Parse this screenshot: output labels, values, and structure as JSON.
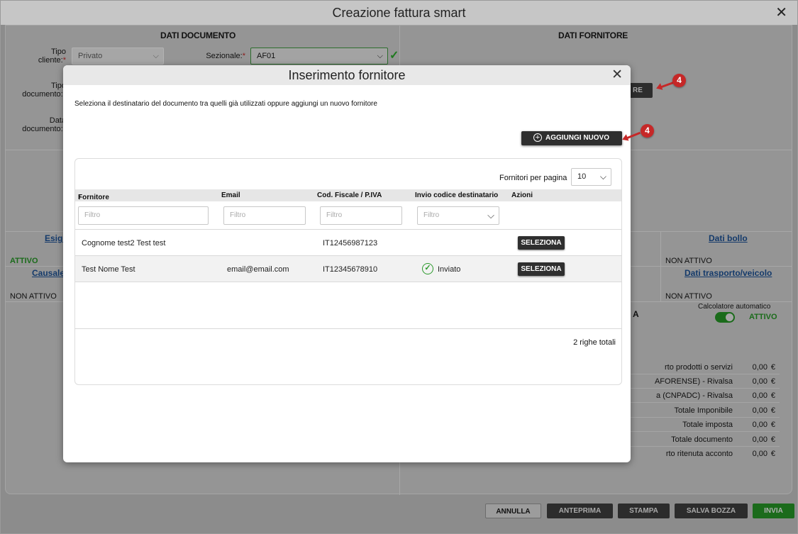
{
  "window": {
    "title": "Creazione fattura smart"
  },
  "dati_documento": {
    "title": "DATI DOCUMENTO",
    "tipo_cliente_label": "Tipo cliente:",
    "tipo_cliente_value": "Privato",
    "sezionale_label": "Sezionale:",
    "sezionale_value": "AF01",
    "tipo_documento_label": "Tipo documento:",
    "data_documento_label": "Data documento:"
  },
  "dati_fornitore": {
    "title": "DATI FORNITORE",
    "button_partial": "RE"
  },
  "sections": {
    "esigibilita_link": "Esigi",
    "esigibilita_status": "ATTIVO",
    "causale_link": "Causale",
    "causale_status": "NON ATTIVO",
    "dati_bollo_link": "Dati bollo",
    "dati_bollo_status": "NON ATTIVO",
    "trasporto_link": "Dati trasporto/veicolo",
    "trasporto_status": "NON ATTIVO",
    "riepilogo_partial": "A"
  },
  "calcolatore": {
    "label": "Calcolatore automatico",
    "status": "ATTIVO"
  },
  "totals": [
    {
      "label": "rto prodotti o servizi",
      "value": "0,00",
      "currency": "€"
    },
    {
      "label": "AFORENSE) - Rivalsa",
      "value": "0,00",
      "currency": "€"
    },
    {
      "label": "a (CNPADC) - Rivalsa",
      "value": "0,00",
      "currency": "€"
    },
    {
      "label": "Totale Imponibile",
      "value": "0,00",
      "currency": "€"
    },
    {
      "label": "Totale imposta",
      "value": "0,00",
      "currency": "€"
    },
    {
      "label": "Totale documento",
      "value": "0,00",
      "currency": "€"
    },
    {
      "label": "rto ritenuta acconto",
      "value": "0,00",
      "currency": "€"
    }
  ],
  "footer": {
    "annulla": "ANNULLA",
    "anteprima": "ANTEPRIMA",
    "stampa": "STAMPA",
    "salva_bozza": "SALVA BOZZA",
    "invia": "INVIA"
  },
  "modal": {
    "title": "Inserimento fornitore",
    "intro": "Seleziona il destinatario del documento tra quelli già utilizzati oppure aggiungi un nuovo fornitore",
    "add_button": "AGGIUNGI NUOVO",
    "per_page_label": "Fornitori per pagina",
    "per_page_value": "10",
    "columns": {
      "fornitore": "Fornitore",
      "email": "Email",
      "cod_fiscale": "Cod. Fiscale / P.IVA",
      "invio": "Invio codice destinatario",
      "azioni": "Azioni"
    },
    "filter_placeholder": "Filtro",
    "rows": [
      {
        "fornitore": "Cognome test2 Test test",
        "email": "",
        "cod_fiscale": "IT12456987123",
        "invio": "",
        "action": "SELEZIONA"
      },
      {
        "fornitore": "Test Nome Test",
        "email": "email@email.com",
        "cod_fiscale": "IT12345678910",
        "invio": "Inviato",
        "action": "SELEZIONA"
      }
    ],
    "total_rows": "2 righe totali"
  },
  "annotations": {
    "marker_1": "4",
    "marker_2": "4"
  },
  "colors": {
    "accent_green": "#1b6b1b",
    "marker_red": "#c62828",
    "dark_button": "#2f2f2f"
  }
}
